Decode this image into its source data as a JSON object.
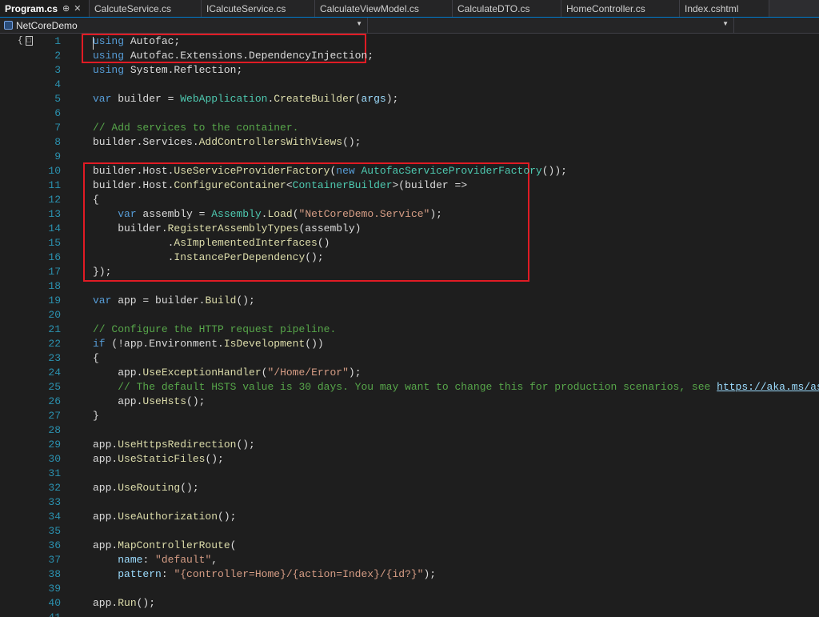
{
  "tabs": [
    {
      "label": "Program.cs",
      "active": true
    },
    {
      "label": "CalcuteService.cs"
    },
    {
      "label": "ICalcuteService.cs"
    },
    {
      "label": "CalculateViewModel.cs"
    },
    {
      "label": "CalculateDTO.cs"
    },
    {
      "label": "HomeController.cs"
    },
    {
      "label": "Index.cshtml"
    }
  ],
  "navbar": {
    "project": "NetCoreDemo"
  },
  "code_lines": [
    [
      [
        "kw",
        "using"
      ],
      [
        "p",
        " Autofac;"
      ]
    ],
    [
      [
        "kw",
        "using"
      ],
      [
        "p",
        " Autofac.Extensions.DependencyInjection;"
      ]
    ],
    [
      [
        "kw",
        "using"
      ],
      [
        "p",
        " System.Reflection;"
      ]
    ],
    [],
    [
      [
        "kw",
        "var"
      ],
      [
        "p",
        " builder = "
      ],
      [
        "type",
        "WebApplication"
      ],
      [
        "p",
        "."
      ],
      [
        "method",
        "CreateBuilder"
      ],
      [
        "p",
        "("
      ],
      [
        "param",
        "args"
      ],
      [
        "p",
        ");"
      ]
    ],
    [],
    [
      [
        "comment",
        "// Add services to the container."
      ]
    ],
    [
      [
        "p",
        "builder.Services."
      ],
      [
        "method",
        "AddControllersWithViews"
      ],
      [
        "p",
        "();"
      ]
    ],
    [],
    [
      [
        "p",
        "builder.Host."
      ],
      [
        "method",
        "UseServiceProviderFactory"
      ],
      [
        "p",
        "("
      ],
      [
        "kw",
        "new"
      ],
      [
        "p",
        " "
      ],
      [
        "type",
        "AutofacServiceProviderFactory"
      ],
      [
        "p",
        "());"
      ]
    ],
    [
      [
        "p",
        "builder.Host."
      ],
      [
        "method",
        "ConfigureContainer"
      ],
      [
        "p",
        "<"
      ],
      [
        "type",
        "ContainerBuilder"
      ],
      [
        "p",
        ">(builder =>"
      ]
    ],
    [
      [
        "p",
        "{"
      ]
    ],
    [
      [
        "p",
        "    "
      ],
      [
        "kw",
        "var"
      ],
      [
        "p",
        " assembly = "
      ],
      [
        "type",
        "Assembly"
      ],
      [
        "p",
        "."
      ],
      [
        "method",
        "Load"
      ],
      [
        "p",
        "("
      ],
      [
        "str",
        "\"NetCoreDemo.Service\""
      ],
      [
        "p",
        ");"
      ]
    ],
    [
      [
        "p",
        "    builder."
      ],
      [
        "method",
        "RegisterAssemblyTypes"
      ],
      [
        "p",
        "(assembly)"
      ]
    ],
    [
      [
        "p",
        "            ."
      ],
      [
        "method",
        "AsImplementedInterfaces"
      ],
      [
        "p",
        "()"
      ]
    ],
    [
      [
        "p",
        "            ."
      ],
      [
        "method",
        "InstancePerDependency"
      ],
      [
        "p",
        "();"
      ]
    ],
    [
      [
        "p",
        "});"
      ]
    ],
    [],
    [
      [
        "kw",
        "var"
      ],
      [
        "p",
        " app = builder."
      ],
      [
        "method",
        "Build"
      ],
      [
        "p",
        "();"
      ]
    ],
    [],
    [
      [
        "comment",
        "// Configure the HTTP request pipeline."
      ]
    ],
    [
      [
        "kw",
        "if"
      ],
      [
        "p",
        " (!app.Environment."
      ],
      [
        "method",
        "IsDevelopment"
      ],
      [
        "p",
        "())"
      ]
    ],
    [
      [
        "p",
        "{"
      ]
    ],
    [
      [
        "p",
        "    app."
      ],
      [
        "method",
        "UseExceptionHandler"
      ],
      [
        "p",
        "("
      ],
      [
        "str",
        "\"/Home/Error\""
      ],
      [
        "p",
        ");"
      ]
    ],
    [
      [
        "p",
        "    "
      ],
      [
        "comment",
        "// The default HSTS value is 30 days. You may want to change this for production scenarios, see "
      ],
      [
        "link",
        "https://aka.ms/aspnetcore-hsts"
      ],
      [
        "comment",
        "."
      ]
    ],
    [
      [
        "p",
        "    app."
      ],
      [
        "method",
        "UseHsts"
      ],
      [
        "p",
        "();"
      ]
    ],
    [
      [
        "p",
        "}"
      ]
    ],
    [],
    [
      [
        "p",
        "app."
      ],
      [
        "method",
        "UseHttpsRedirection"
      ],
      [
        "p",
        "();"
      ]
    ],
    [
      [
        "p",
        "app."
      ],
      [
        "method",
        "UseStaticFiles"
      ],
      [
        "p",
        "();"
      ]
    ],
    [],
    [
      [
        "p",
        "app."
      ],
      [
        "method",
        "UseRouting"
      ],
      [
        "p",
        "();"
      ]
    ],
    [],
    [
      [
        "p",
        "app."
      ],
      [
        "method",
        "UseAuthorization"
      ],
      [
        "p",
        "();"
      ]
    ],
    [],
    [
      [
        "p",
        "app."
      ],
      [
        "method",
        "MapControllerRoute"
      ],
      [
        "p",
        "("
      ]
    ],
    [
      [
        "p",
        "    "
      ],
      [
        "param",
        "name"
      ],
      [
        "p",
        ": "
      ],
      [
        "str",
        "\"default\""
      ],
      [
        "p",
        ","
      ]
    ],
    [
      [
        "p",
        "    "
      ],
      [
        "param",
        "pattern"
      ],
      [
        "p",
        ": "
      ],
      [
        "str",
        "\"{controller=Home}/{action=Index}/{id?}\""
      ],
      [
        "p",
        ");"
      ]
    ],
    [],
    [
      [
        "p",
        "app."
      ],
      [
        "method",
        "Run"
      ],
      [
        "p",
        "();"
      ]
    ],
    []
  ],
  "colors": {
    "highlight_box": "#e01b24",
    "keyword": "#569cd6",
    "type": "#4ec9b0",
    "method": "#dcdcaa",
    "string": "#d69d85",
    "comment": "#57a64a",
    "line_number": "#2b91af"
  },
  "icons": {
    "pin": "pin-icon",
    "close": "close-icon",
    "outline": "collapse-outline-icon",
    "project": "csharp-project-icon"
  }
}
